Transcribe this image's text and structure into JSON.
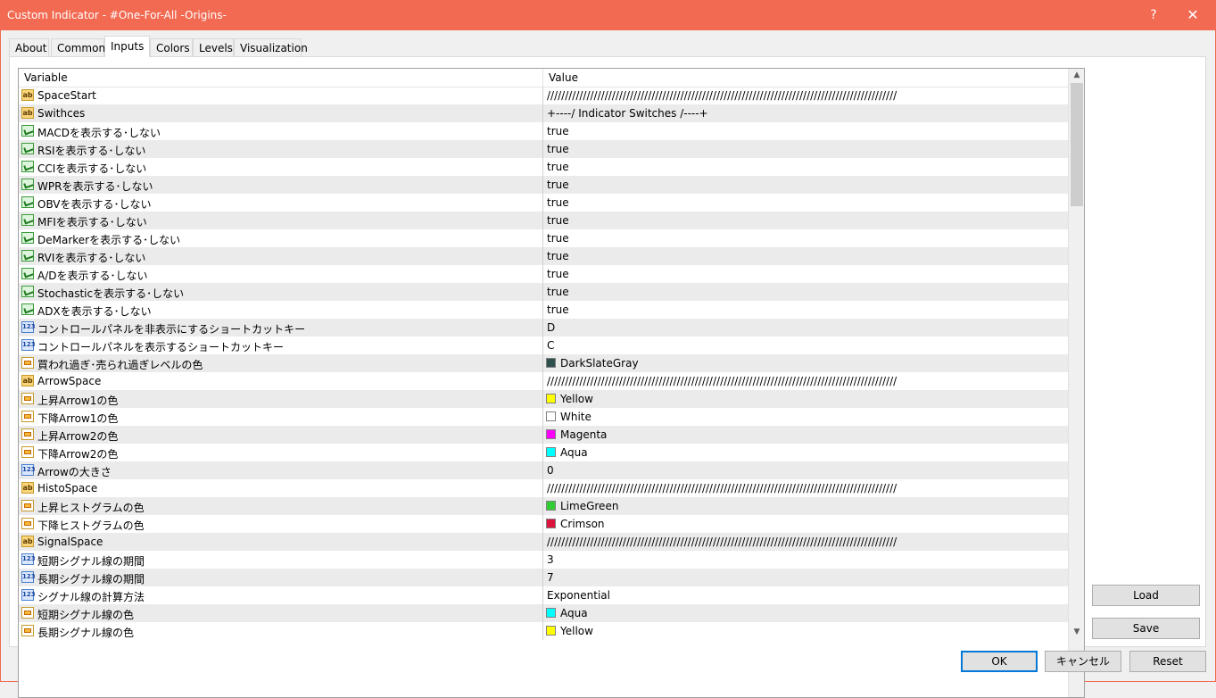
{
  "window": {
    "title": "Custom Indicator - #One-For-All -Origins-",
    "help_glyph": "?",
    "close_glyph": "✕"
  },
  "tabs": [
    {
      "label": "About"
    },
    {
      "label": "Common"
    },
    {
      "label": "Inputs",
      "active": true
    },
    {
      "label": "Colors"
    },
    {
      "label": "Levels"
    },
    {
      "label": "Visualization"
    }
  ],
  "grid": {
    "col_variable": "Variable",
    "col_value": "Value",
    "rows": [
      {
        "type": "string",
        "name": "SpaceStart",
        "value": "/////////////////////////////////////////////////////////////////////////////////////////////////"
      },
      {
        "type": "string",
        "name": "Swithces",
        "value": "+----/ Indicator Switches /----+"
      },
      {
        "type": "bool",
        "name": "MACDを表示する･しない",
        "value": "true"
      },
      {
        "type": "bool",
        "name": "RSIを表示する･しない",
        "value": "true"
      },
      {
        "type": "bool",
        "name": "CCIを表示する･しない",
        "value": "true"
      },
      {
        "type": "bool",
        "name": "WPRを表示する･しない",
        "value": "true"
      },
      {
        "type": "bool",
        "name": "OBVを表示する･しない",
        "value": "true"
      },
      {
        "type": "bool",
        "name": "MFIを表示する･しない",
        "value": "true"
      },
      {
        "type": "bool",
        "name": "DeMarkerを表示する･しない",
        "value": "true"
      },
      {
        "type": "bool",
        "name": "RVIを表示する･しない",
        "value": "true"
      },
      {
        "type": "bool",
        "name": "A/Dを表示する･しない",
        "value": "true"
      },
      {
        "type": "bool",
        "name": "Stochasticを表示する･しない",
        "value": "true"
      },
      {
        "type": "bool",
        "name": "ADXを表示する･しない",
        "value": "true"
      },
      {
        "type": "number",
        "name": "コントロールパネルを非表示にするショートカットキー",
        "value": "D"
      },
      {
        "type": "number",
        "name": "コントロールパネルを表示するショートカットキー",
        "value": "C"
      },
      {
        "type": "color",
        "name": "買われ過ぎ･売られ過ぎレベルの色",
        "value": "DarkSlateGray",
        "color": "#2f4f4f"
      },
      {
        "type": "string",
        "name": "ArrowSpace",
        "value": "/////////////////////////////////////////////////////////////////////////////////////////////////"
      },
      {
        "type": "color",
        "name": "上昇Arrow1の色",
        "value": "Yellow",
        "color": "#ffff00"
      },
      {
        "type": "color",
        "name": "下降Arrow1の色",
        "value": "White",
        "color": "#ffffff"
      },
      {
        "type": "color",
        "name": "上昇Arrow2の色",
        "value": "Magenta",
        "color": "#ff00ff"
      },
      {
        "type": "color",
        "name": "下降Arrow2の色",
        "value": "Aqua",
        "color": "#00ffff"
      },
      {
        "type": "number",
        "name": "Arrowの大きさ",
        "value": "0"
      },
      {
        "type": "string",
        "name": "HistoSpace",
        "value": "/////////////////////////////////////////////////////////////////////////////////////////////////"
      },
      {
        "type": "color",
        "name": "上昇ヒストグラムの色",
        "value": "LimeGreen",
        "color": "#32cd32"
      },
      {
        "type": "color",
        "name": "下降ヒストグラムの色",
        "value": "Crimson",
        "color": "#dc143c"
      },
      {
        "type": "string",
        "name": "SignalSpace",
        "value": "/////////////////////////////////////////////////////////////////////////////////////////////////"
      },
      {
        "type": "number",
        "name": "短期シグナル線の期間",
        "value": "3"
      },
      {
        "type": "number",
        "name": "長期シグナル線の期間",
        "value": "7"
      },
      {
        "type": "number",
        "name": "シグナル線の計算方法",
        "value": "Exponential"
      },
      {
        "type": "color",
        "name": "短期シグナル線の色",
        "value": "Aqua",
        "color": "#00ffff"
      },
      {
        "type": "color",
        "name": "長期シグナル線の色",
        "value": "Yellow",
        "color": "#ffff00"
      }
    ]
  },
  "icons": {
    "string": "ab-icon",
    "bool": "bool-check-icon",
    "number": "number-icon",
    "color": "color-icon"
  },
  "buttons": {
    "load": "Load",
    "save": "Save",
    "ok": "OK",
    "cancel": "キャンセル",
    "reset": "Reset"
  }
}
